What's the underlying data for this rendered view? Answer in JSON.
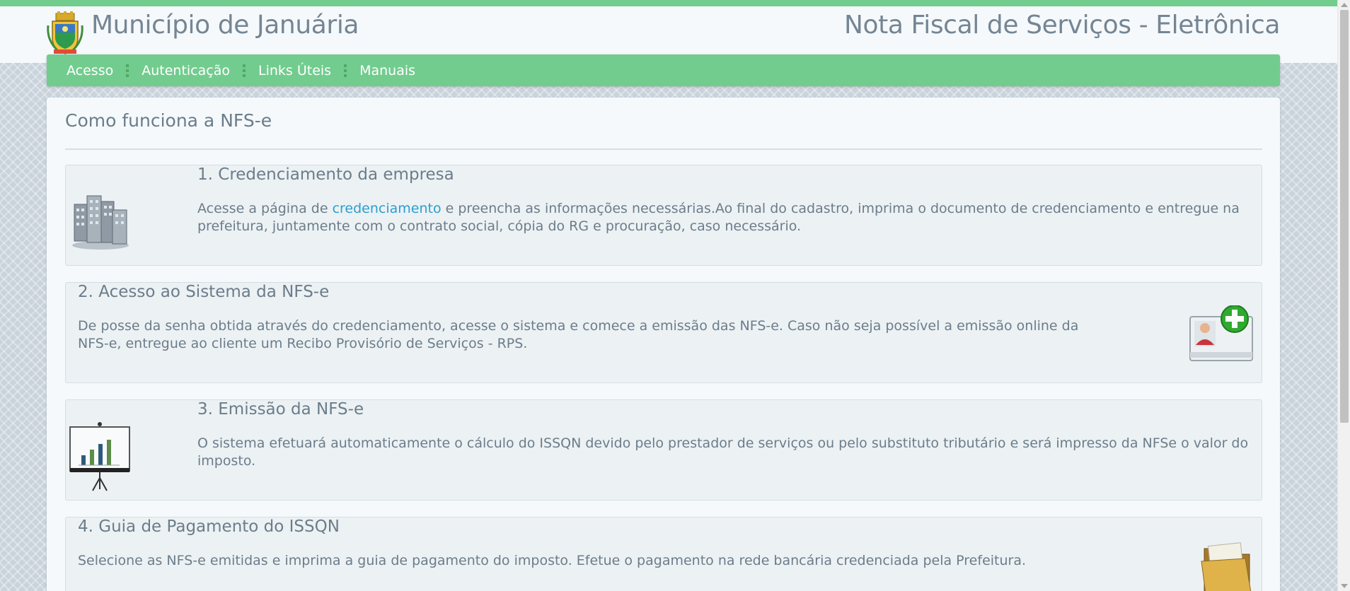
{
  "header": {
    "site_title": "Município de Januária",
    "system_title": "Nota Fiscal de Serviços - Eletrônica",
    "crest_icon": "municipal-crest"
  },
  "nav": {
    "items": [
      {
        "label": "Acesso"
      },
      {
        "label": "Autenticação"
      },
      {
        "label": "Links Úteis"
      },
      {
        "label": "Manuais"
      }
    ]
  },
  "main": {
    "title": "Como funciona a NFS-e",
    "steps": [
      {
        "title": "1. Credenciamento da empresa",
        "text_before": "Acesse a página de ",
        "link": "credenciamento",
        "text_after": " e preencha as informações necessárias.Ao final do cadastro, imprima o documento de credenciamento e entregue na prefeitura, juntamente com o contrato social, cópia do RG e procuração, caso necessário.",
        "icon": "buildings-icon"
      },
      {
        "title": "2. Acesso ao Sistema da NFS-e",
        "text": "De posse da senha obtida através do credenciamento, acesse o sistema e comece a emissão das NFS-e. Caso não seja possível a emissão online da NFS-e, entregue ao cliente um Recibo Provisório de Serviços - RPS.",
        "icon": "user-card-add-icon"
      },
      {
        "title": "3. Emissão da NFS-e",
        "text": "O sistema efetuará automaticamente o cálculo do ISSQN devido pelo prestador de serviços ou pelo substituto tributário e será impresso da NFSe o valor do imposto.",
        "icon": "presentation-chart-icon"
      },
      {
        "title": "4. Guia de Pagamento do ISSQN",
        "text": "Selecione as NFS-e emitidas e imprima a guia de pagamento do imposto. Efetue o pagamento na rede bancária credenciada pela Prefeitura.",
        "icon": "folder-icon"
      }
    ]
  },
  "colors": {
    "accent_green": "#72cc8e",
    "link_blue": "#2a9fd0",
    "text_gray": "#6b7d8a"
  }
}
